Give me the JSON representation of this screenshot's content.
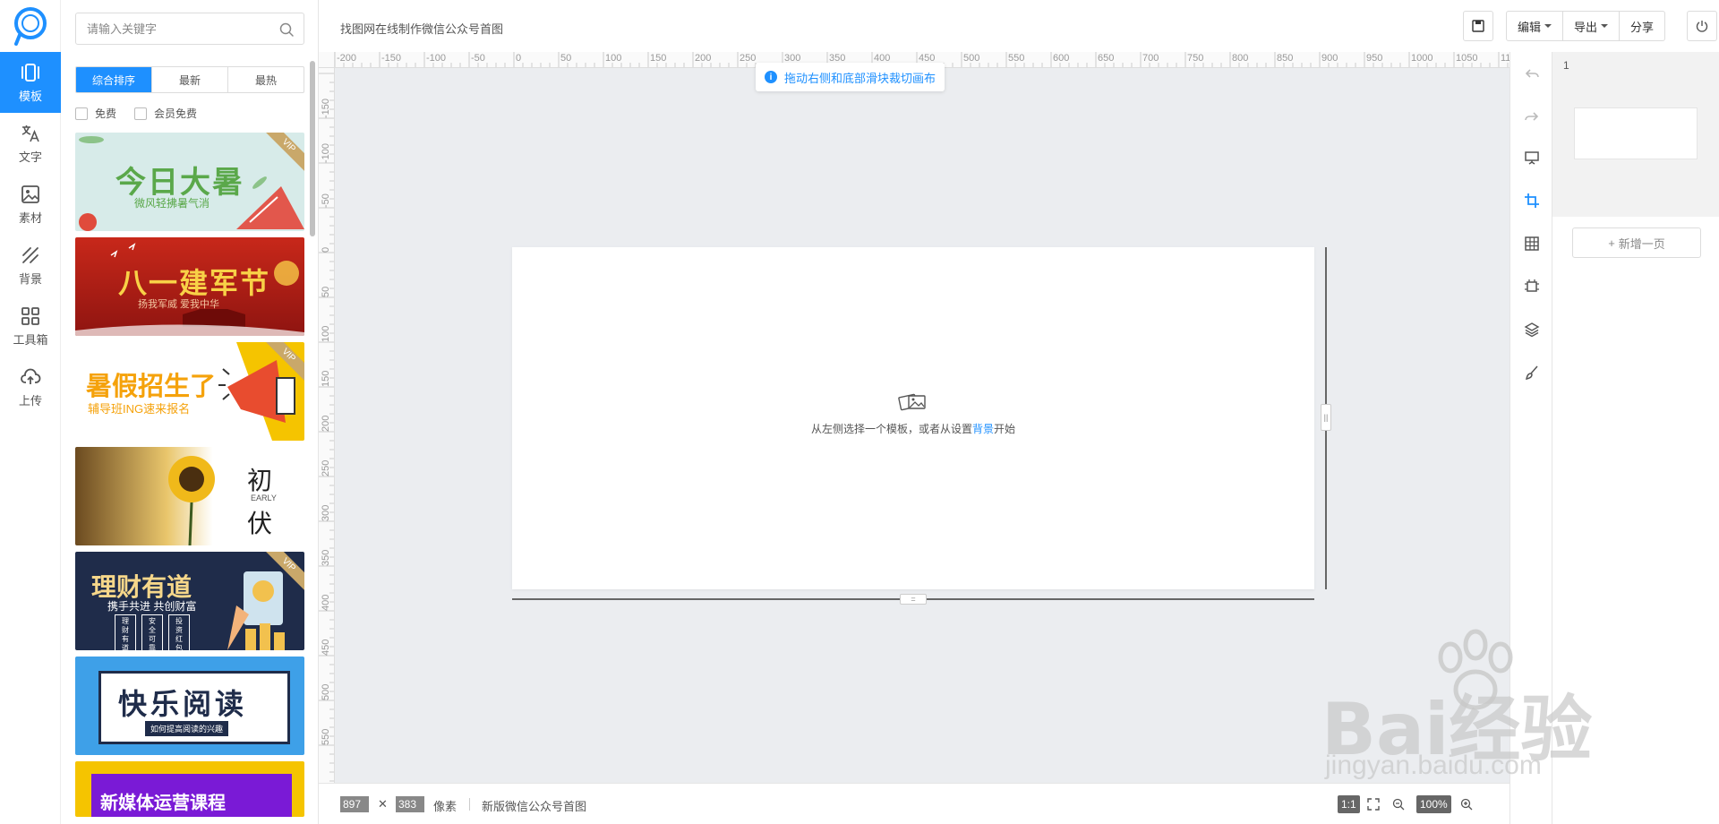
{
  "nav": {
    "items": [
      {
        "label": "模板",
        "icon": "template-icon",
        "active": true
      },
      {
        "label": "文字",
        "icon": "text-translate-icon",
        "active": false
      },
      {
        "label": "素材",
        "icon": "image-icon",
        "active": false
      },
      {
        "label": "背景",
        "icon": "background-stripes-icon",
        "active": false
      },
      {
        "label": "工具箱",
        "icon": "grid-toolbox-icon",
        "active": false
      },
      {
        "label": "上传",
        "icon": "cloud-upload-icon",
        "active": false
      }
    ]
  },
  "search": {
    "placeholder": "请输入关键字"
  },
  "sort_tabs": [
    "综合排序",
    "最新",
    "最热"
  ],
  "filters": [
    "免费",
    "会员免费"
  ],
  "templates": [
    {
      "title": "今日大暑",
      "subtitle": "微风轻拂暑气消",
      "vip": "VIP"
    },
    {
      "title": "八一建军节",
      "subtitle": "扬我军威 爱我中华"
    },
    {
      "title": "暑假招生了",
      "subtitle": "辅导班ING速来报名",
      "vip": "VIP"
    },
    {
      "title": "初",
      "subtitle": "EARLY",
      "title2": "伏"
    },
    {
      "title": "理财有道",
      "subtitle": "携手共进 共创财富",
      "chips": [
        "理财有道",
        "安全可靠",
        "投资红包"
      ],
      "vip": "VIP"
    },
    {
      "title": "快乐阅读",
      "subtitle": "如何提高阅读的兴趣"
    },
    {
      "title": "新媒体运营课程"
    }
  ],
  "topbar": {
    "doc_title": "找图网在线制作微信公众号首图",
    "edit_label": "编辑",
    "export_label": "导出",
    "share_label": "分享"
  },
  "workspace": {
    "tip": "拖动右侧和底部滑块裁切画布",
    "empty_prefix": "从左侧选择一个模板，或者从设置",
    "empty_link": "背景",
    "empty_suffix": "开始",
    "ruler_h": [
      "-200",
      "-150",
      "-100",
      "-50",
      "0",
      "50",
      "100",
      "150",
      "200",
      "250",
      "300",
      "350",
      "400",
      "450",
      "500",
      "550",
      "600",
      "650",
      "700",
      "750",
      "800",
      "850",
      "900",
      "950",
      "1000",
      "1050",
      "11"
    ],
    "ruler_v": [
      "-150",
      "-100",
      "-50",
      "0",
      "50",
      "100",
      "150",
      "200",
      "250",
      "300",
      "350",
      "400",
      "450",
      "500",
      "550"
    ]
  },
  "status": {
    "width": "897",
    "times": "✕",
    "height": "383",
    "unit": "像素",
    "template_name": "新版微信公众号首图",
    "ratio": "1:1",
    "zoom": "100%"
  },
  "pages": {
    "number": "1",
    "add_label": "新增一页"
  },
  "watermark": {
    "brand": "Bai经验",
    "url": "jingyan.baidu.com"
  },
  "colors": {
    "accent": "#1e90ff",
    "workspace_bg": "#ebedf0"
  }
}
